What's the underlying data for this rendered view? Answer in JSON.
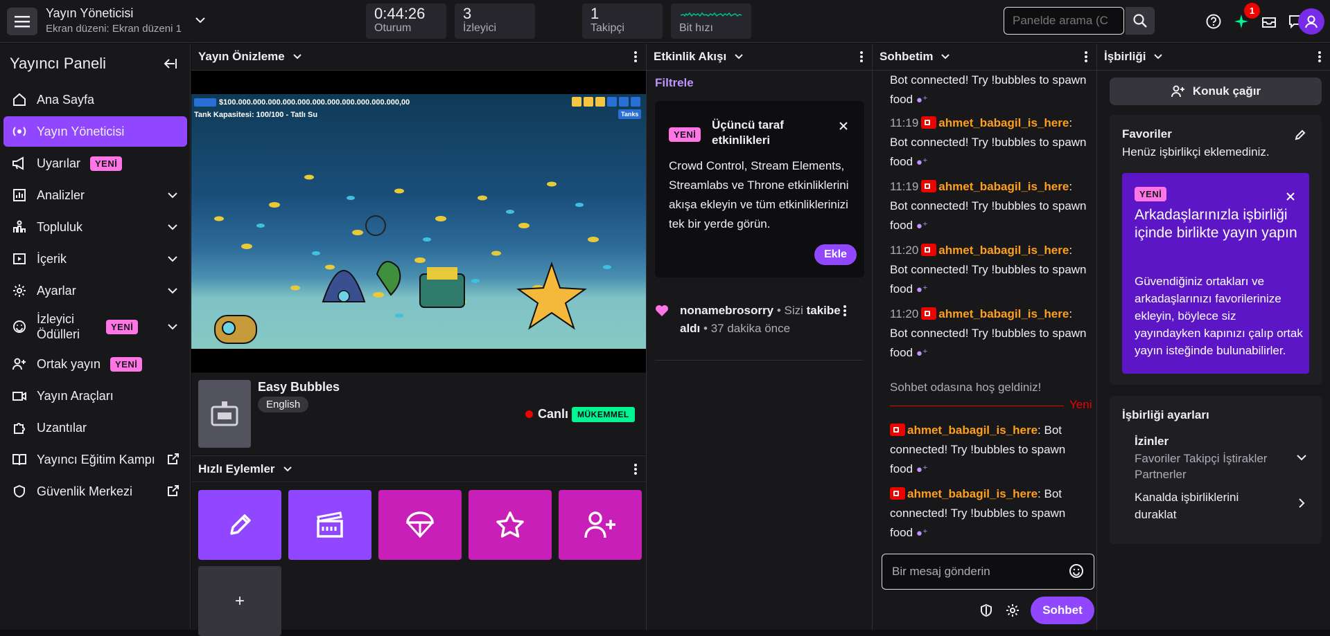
{
  "topbar": {
    "title": "Yayın Yöneticisi",
    "subtitle": "Ekran düzeni: Ekran düzeni 1",
    "stats": [
      {
        "value": "0:44:26",
        "label": "Oturum"
      },
      {
        "value": "3",
        "label": "İzleyici"
      },
      {
        "value": "1",
        "label": "Takipçi"
      },
      {
        "value": "",
        "label": "Bit hızı"
      }
    ],
    "search_placeholder": "Panelde arama (C",
    "notification_count": "1"
  },
  "sidebar": {
    "title": "Yayıncı Paneli",
    "items": [
      {
        "label": "Ana Sayfa",
        "icon": "home-icon"
      },
      {
        "label": "Yayın Yöneticisi",
        "icon": "stream-manager-icon",
        "active": true
      },
      {
        "label": "Uyarılar",
        "icon": "megaphone-icon",
        "badge": "YENİ"
      },
      {
        "label": "Analizler",
        "icon": "chart-icon"
      },
      {
        "label": "Topluluk",
        "icon": "community-icon"
      },
      {
        "label": "İçerik",
        "icon": "content-icon"
      },
      {
        "label": "Ayarlar",
        "icon": "gear-icon"
      },
      {
        "label": "İzleyici Ödülleri",
        "icon": "rewards-icon",
        "badge": "YENİ"
      },
      {
        "label": "Ortak yayın",
        "icon": "add-user-icon",
        "badge": "YENİ"
      },
      {
        "label": "Yayın Araçları",
        "icon": "camera-icon"
      },
      {
        "label": "Uzantılar",
        "icon": "puzzle-icon"
      },
      {
        "label": "Yayıncı Eğitim Kampı",
        "icon": "book-icon"
      },
      {
        "label": "Güvenlik Merkezi",
        "icon": "shield-icon"
      }
    ]
  },
  "preview": {
    "header": "Yayın Önizleme",
    "game_money": "$100.000.000.000.000.000.000.000.000.000.000.000,00",
    "game_tank": "Tank Kapasitesi: 100/100 - Tatlı Su",
    "game_tanks_btn": "Tanks",
    "game_name": "Easy Bubbles",
    "language": "English",
    "live": "Canlı",
    "quality": "MÜKEMMEL"
  },
  "quick_actions": {
    "header": "Hızlı Eylemler",
    "tiles": [
      {
        "icon": "pencil-icon",
        "color": "#9147ff"
      },
      {
        "icon": "clapperboard-icon",
        "color": "#9147ff"
      },
      {
        "icon": "parachute-icon",
        "color": "#c71fb7"
      },
      {
        "icon": "star-icon",
        "color": "#c71fb7"
      },
      {
        "icon": "add-user-icon",
        "color": "#c71fb7"
      }
    ],
    "add_label": "+"
  },
  "activity": {
    "header": "Etkinlik Akışı",
    "filter": "Filtrele",
    "card_badge": "YENİ",
    "card_title": "Üçüncü taraf etkinlikleri",
    "card_body": "Crowd Control, Stream Elements, Streamlabs ve Throne etkinliklerini akışa ekleyin ve tüm etkinliklerinizi tek bir yerde görün.",
    "card_button": "Ekle",
    "event_user": "nonamebrosorry",
    "event_mid": " • Sizi ",
    "event_action": "takibe aldı",
    "event_time": " • 37 dakika önce"
  },
  "chat": {
    "header": "Sohbetim",
    "top_message": "Bot connected! Try !bubbles to spawn food",
    "messages": [
      {
        "time": "11:19",
        "user": "ahmet_babagil_is_here",
        "text": "Bot connected! Try !bubbles to spawn food"
      },
      {
        "time": "11:19",
        "user": "ahmet_babagil_is_here",
        "text": "Bot connected! Try !bubbles to spawn food"
      },
      {
        "time": "11:20",
        "user": "ahmet_babagil_is_here",
        "text": "Bot connected! Try !bubbles to spawn food"
      },
      {
        "time": "11:20",
        "user": "ahmet_babagil_is_here",
        "text": "Bot connected! Try !bubbles to spawn food"
      }
    ],
    "welcome": "Sohbet odasına hoş geldiniz!",
    "new_label": "Yeni",
    "new_messages": [
      {
        "user": "ahmet_babagil_is_here",
        "text": "Bot connected! Try !bubbles to spawn food"
      },
      {
        "user": "ahmet_babagil_is_here",
        "text": "Bot connected! Try !bubbles to spawn food"
      }
    ],
    "input_placeholder": "Bir mesaj gönderin",
    "send": "Sohbet"
  },
  "collab": {
    "header": "İşbirliği",
    "invite": "Konuk çağır",
    "favorites_title": "Favoriler",
    "favorites_empty": "Henüz işbirlikçi eklemediniz.",
    "promo_badge": "YENİ",
    "promo_title": "Arkadaşlarınızla işbirliği içinde birlikte yayın yapın",
    "promo_text": "Güvendiğiniz ortakları ve arkadaşlarınızı favorilerinize ekleyin, böylece siz yayındayken kapınızı çalıp ortak yayın isteğinde bulunabilirler.",
    "settings_title": "İşbirliği ayarları",
    "permissions_label": "İzinler",
    "permissions_value": "Favoriler Takipçi İştirakler Partnerler",
    "pause_label": "Kanalda işbirliklerini duraklat"
  }
}
